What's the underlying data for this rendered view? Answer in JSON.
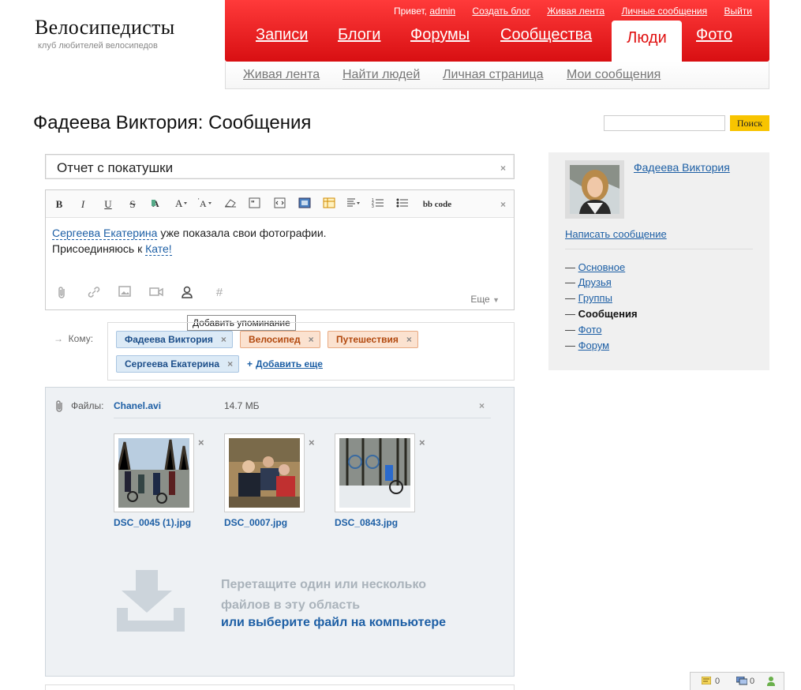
{
  "site": {
    "title": "Велосипедисты",
    "subtitle": "клуб любителей велосипедов"
  },
  "toplinks": {
    "greeting": "Привет,",
    "user": "admin",
    "create_blog": "Создать блог",
    "live_feed": "Живая лента",
    "messages": "Личные сообщения",
    "logout": "Выйти"
  },
  "main_nav": [
    "Записи",
    "Блоги",
    "Форумы",
    "Сообщества",
    "Люди",
    "Фото"
  ],
  "sub_nav": [
    "Живая лента",
    "Найти людей",
    "Личная страница",
    "Мои сообщения"
  ],
  "page_title": "Фадеева Виктория: Сообщения",
  "search": {
    "button": "Поиск",
    "value": ""
  },
  "subject": "Отчет с покатушки",
  "editor": {
    "toolbar": [
      "B",
      "I",
      "U",
      "S",
      "bb code"
    ],
    "mention1": "Сергеева Екатерина",
    "line1_rest": " уже показала свои фотографии.",
    "line2_start": "Присоединяюсь к ",
    "mention2": "Кате!",
    "more": "Еще",
    "tooltip": "Добавить упоминание"
  },
  "recipients": {
    "label": "Кому:",
    "tags": [
      "Фадеева Виктория",
      "Велосипед",
      "Путешествия",
      "Сергеева Екатерина"
    ],
    "add_more": "Добавить еще"
  },
  "files": {
    "label": "Файлы:",
    "file_name": "Chanel.avi",
    "file_size": "14.7 МБ",
    "images": [
      "DSC_0045 (1).jpg",
      "DSC_0007.jpg",
      "DSC_0843.jpg"
    ],
    "drop_line1": "Перетащите один или несколько",
    "drop_line2": "файлов в эту область",
    "drop_link": "или выберите файл на компьютере"
  },
  "sidebar": {
    "name": "Фадеева Виктория",
    "write": "Написать сообщение",
    "items": [
      "Основное",
      "Друзья",
      "Группы",
      "Сообщения",
      "Фото",
      "Форум"
    ]
  },
  "widget": {
    "count1": "0",
    "count2": "0"
  },
  "colors": {
    "red": "#e01010",
    "link": "#1d5fa5",
    "search": "#f8c400"
  }
}
